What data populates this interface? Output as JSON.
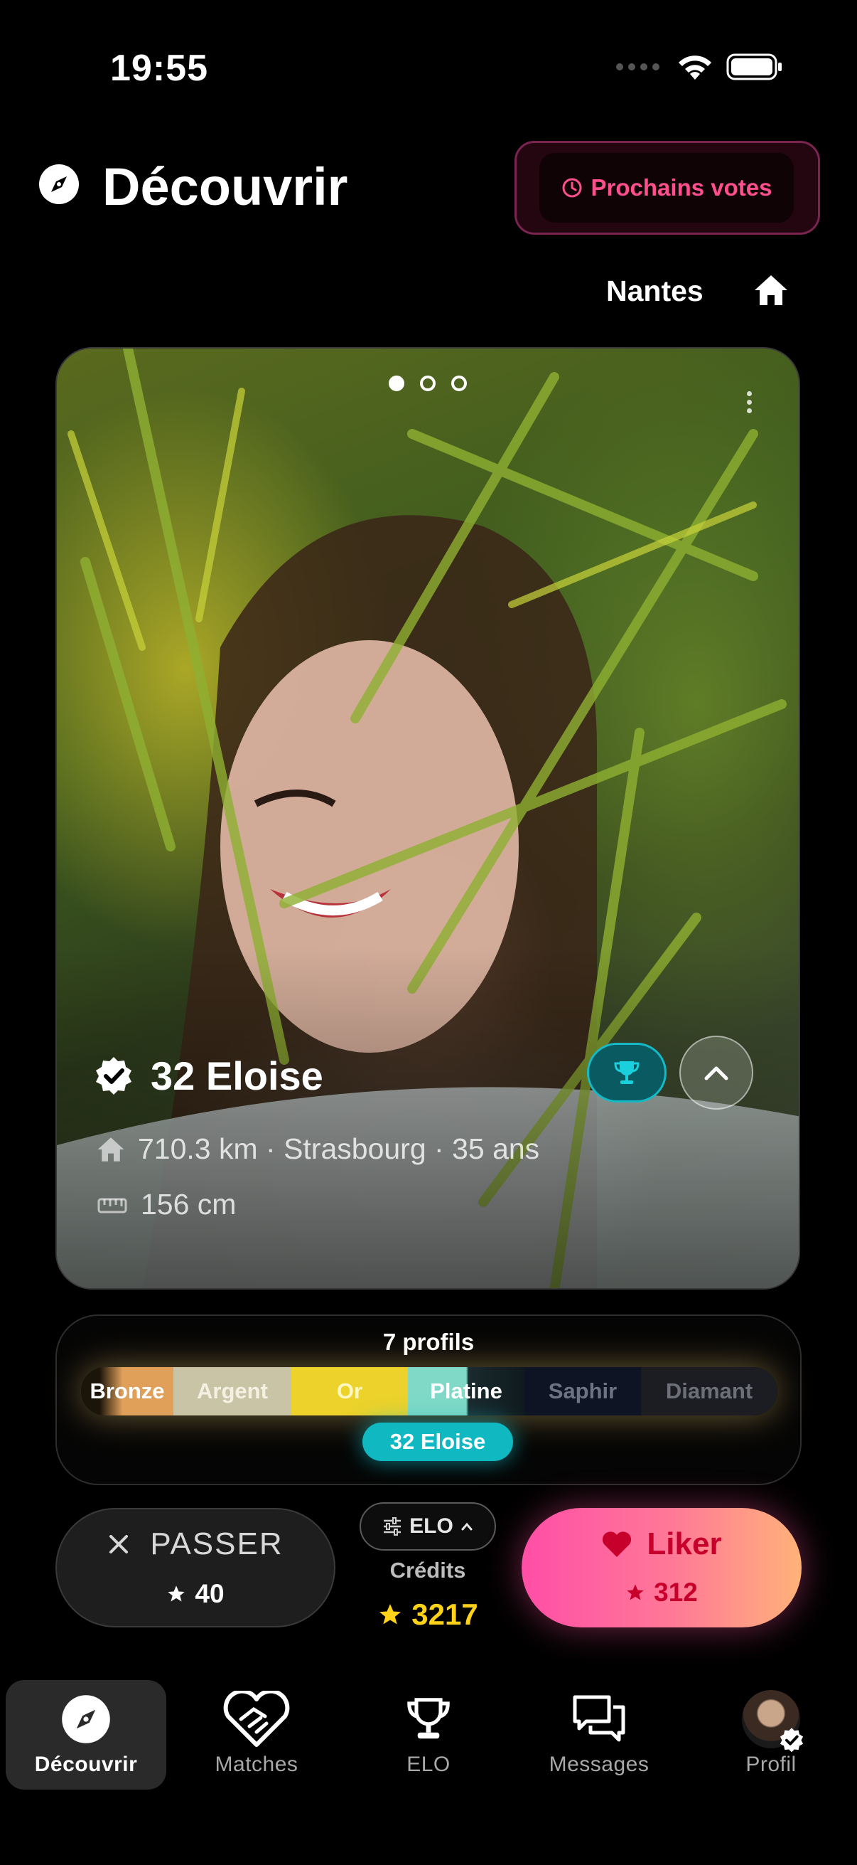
{
  "status_bar": {
    "time": "19:55"
  },
  "header": {
    "title": "Découvrir",
    "votes_button": "Prochains votes"
  },
  "location": {
    "city": "Nantes"
  },
  "profile": {
    "name": "32 Eloise",
    "details": "710.3 km · Strasbourg · 35 ans",
    "height": "156 cm",
    "photo_count": 3,
    "photo_index": 1
  },
  "ranking": {
    "count_label": "7 profils",
    "tiers": [
      {
        "label": "Bronze",
        "color": "#e0a05a",
        "text": "#ffffff"
      },
      {
        "label": "Argent",
        "color": "#c9c4a6",
        "text": "#f4f1e3"
      },
      {
        "label": "Or",
        "color": "#ecd22a",
        "text": "#fff7c2"
      },
      {
        "label": "Platine",
        "color": "#7fd9c6",
        "text": "#ffffff"
      },
      {
        "label": "Saphir",
        "color": "#0e1424",
        "text": "#6d7382"
      },
      {
        "label": "Diamant",
        "color": "#1b1d22",
        "text": "#6d7078"
      }
    ],
    "current_label": "32 Eloise"
  },
  "actions": {
    "pass_label": "PASSER",
    "pass_count": "40",
    "elo_label": "ELO",
    "credits_label": "Crédits",
    "credits_value": "3217",
    "like_label": "Liker",
    "like_count": "312"
  },
  "nav": {
    "items": [
      {
        "label": "Découvrir",
        "icon": "compass-icon",
        "active": true
      },
      {
        "label": "Matches",
        "icon": "handshake-heart-icon",
        "active": false
      },
      {
        "label": "ELO",
        "icon": "trophy-icon",
        "active": false
      },
      {
        "label": "Messages",
        "icon": "chat-bubbles-icon",
        "active": false
      },
      {
        "label": "Profil",
        "icon": "avatar",
        "active": false
      }
    ]
  },
  "colors": {
    "accent_pink": "#ff4f8e",
    "teal": "#10b8c2",
    "gold": "#ffd21a",
    "like_red": "#c7002b"
  }
}
